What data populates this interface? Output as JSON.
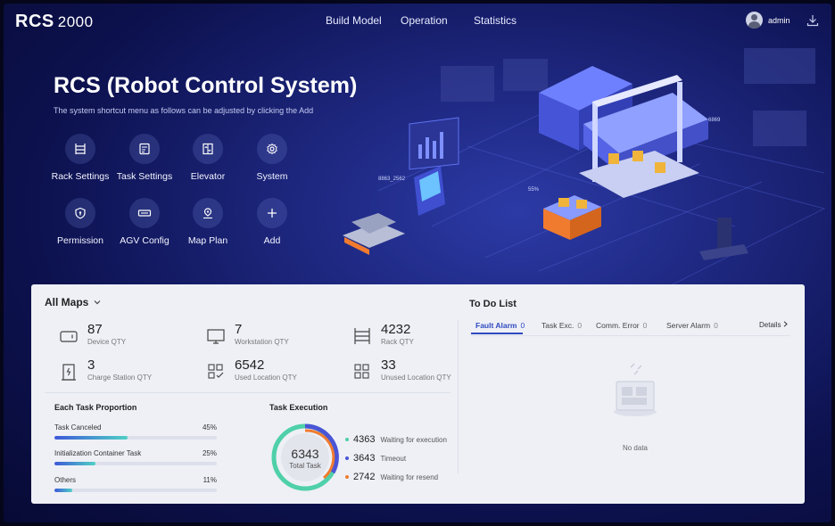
{
  "header": {
    "logo": "RCS",
    "version": "2000",
    "nav": [
      "Build  Model",
      "Operation",
      "Statistics"
    ],
    "user": "admin"
  },
  "hero": {
    "title": "RCS (Robot Control System)",
    "subtitle": "The system shortcut menu as follows can be adjusted by clicking the Add",
    "shortcuts": [
      {
        "label": "Rack Settings",
        "icon": "rack-icon"
      },
      {
        "label": "Task Settings",
        "icon": "task-icon"
      },
      {
        "label": "Elevator",
        "icon": "elevator-icon"
      },
      {
        "label": "System",
        "icon": "gear-icon"
      },
      {
        "label": "Permission",
        "icon": "shield-icon"
      },
      {
        "label": "AGV Config",
        "icon": "agv-icon"
      },
      {
        "label": "Map Plan",
        "icon": "map-pin-icon"
      },
      {
        "label": "Add",
        "icon": "plus-icon"
      }
    ],
    "illustration_labels": [
      "8863_2562",
      "55%",
      "6869"
    ]
  },
  "panel": {
    "maps_label": "All Maps",
    "stats": [
      {
        "value": "87",
        "label": "Device QTY",
        "icon": "device-icon"
      },
      {
        "value": "7",
        "label": "Workstation QTY",
        "icon": "monitor-icon"
      },
      {
        "value": "4232",
        "label": "Rack QTY",
        "icon": "rack-icon"
      },
      {
        "value": "3",
        "label": "Charge Station QTY",
        "icon": "charge-station-icon"
      },
      {
        "value": "6542",
        "label": "Used Location QTY",
        "icon": "used-location-icon"
      },
      {
        "value": "33",
        "label": "Unused Location QTY",
        "icon": "unused-location-icon"
      }
    ],
    "proportion_title": "Each Task Proportion",
    "proportions": [
      {
        "label": "Task Canceled",
        "percent": "45%",
        "value": 0.45
      },
      {
        "label": "Initialization Container Task",
        "percent": "25%",
        "value": 0.25
      },
      {
        "label": "Others",
        "percent": "11%",
        "value": 0.11
      }
    ],
    "execution_title": "Task Execution",
    "total": "6343",
    "total_label": "Total Task",
    "execution": [
      {
        "value": "4363",
        "label": "Waiting for execution",
        "color": "#4fd0a8"
      },
      {
        "value": "3643",
        "label": "Timeout",
        "color": "#4a55d6"
      },
      {
        "value": "2742",
        "label": "Waiting for resend",
        "color": "#f07b2f"
      }
    ]
  },
  "todo": {
    "title": "To Do List",
    "tabs": [
      {
        "label": "Fault Alarm",
        "count": "0"
      },
      {
        "label": "Task Exc.",
        "count": "0"
      },
      {
        "label": "Comm. Error",
        "count": "0"
      },
      {
        "label": "Server Alarm",
        "count": "0"
      }
    ],
    "details": "Details",
    "empty": "No data"
  },
  "colors": {
    "accent": "#2f4ac0",
    "bg_dark": "#0d1250",
    "panel": "#eef0f6"
  }
}
